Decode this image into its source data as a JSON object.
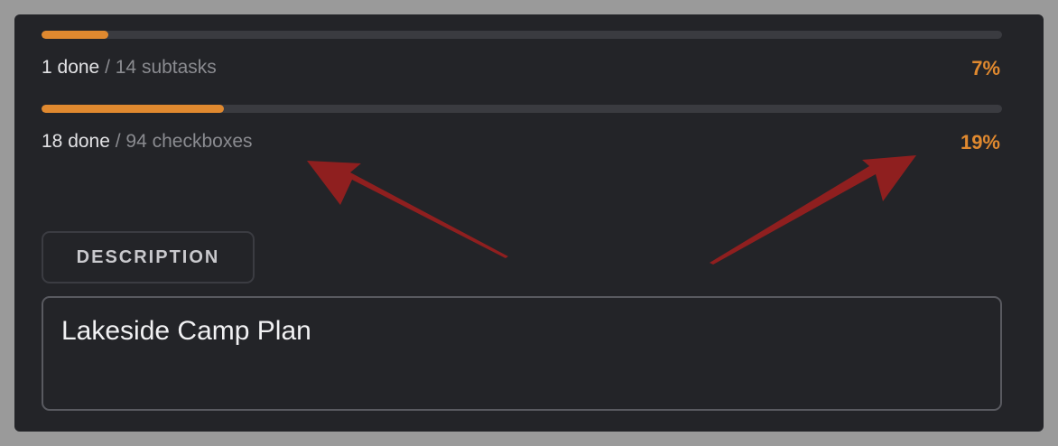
{
  "colors": {
    "accent": "#e0892f",
    "arrow": "#8f1f1f"
  },
  "progress": [
    {
      "done_label": "1 done",
      "total_label": "/ 14 subtasks",
      "percent_label": "7%",
      "fraction": 0.07
    },
    {
      "done_label": "18 done",
      "total_label": "/ 94 checkboxes",
      "percent_label": "19%",
      "fraction": 0.19
    }
  ],
  "description": {
    "tab_label": "DESCRIPTION",
    "value": "Lakeside Camp Plan"
  }
}
